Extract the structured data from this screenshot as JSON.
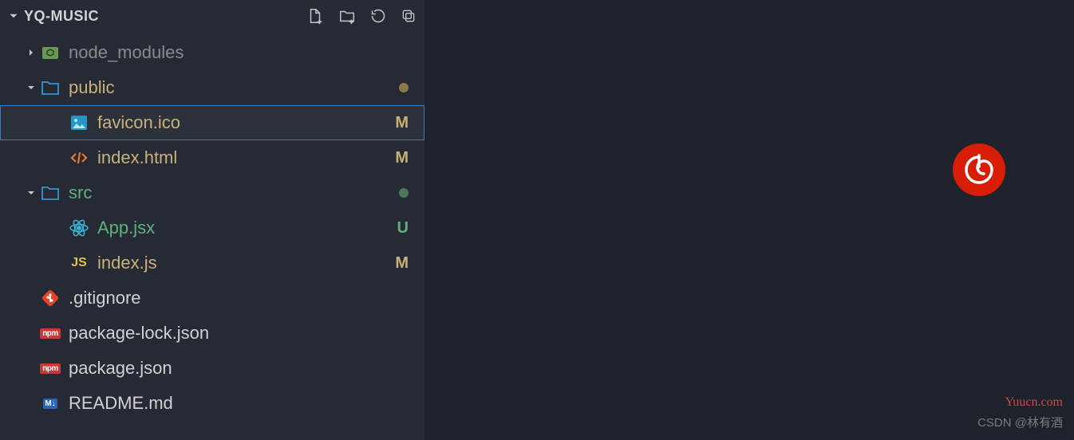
{
  "project": "YQ-MUSIC",
  "statusColors": {
    "M": "#c9b178",
    "U": "#5fb37a"
  },
  "tree": {
    "node_modules": "node_modules",
    "public": "public",
    "favicon": "favicon.ico",
    "favicon_badge": "M",
    "indexhtml": "index.html",
    "indexhtml_badge": "M",
    "src": "src",
    "appjsx": "App.jsx",
    "appjsx_badge": "U",
    "indexjs": "index.js",
    "indexjs_badge": "M",
    "gitignore": ".gitignore",
    "pkglock": "package-lock.json",
    "pkg": "package.json",
    "readme": "README.md"
  },
  "watermark1": "Yuucn.com",
  "watermark2": "CSDN @林有酒"
}
